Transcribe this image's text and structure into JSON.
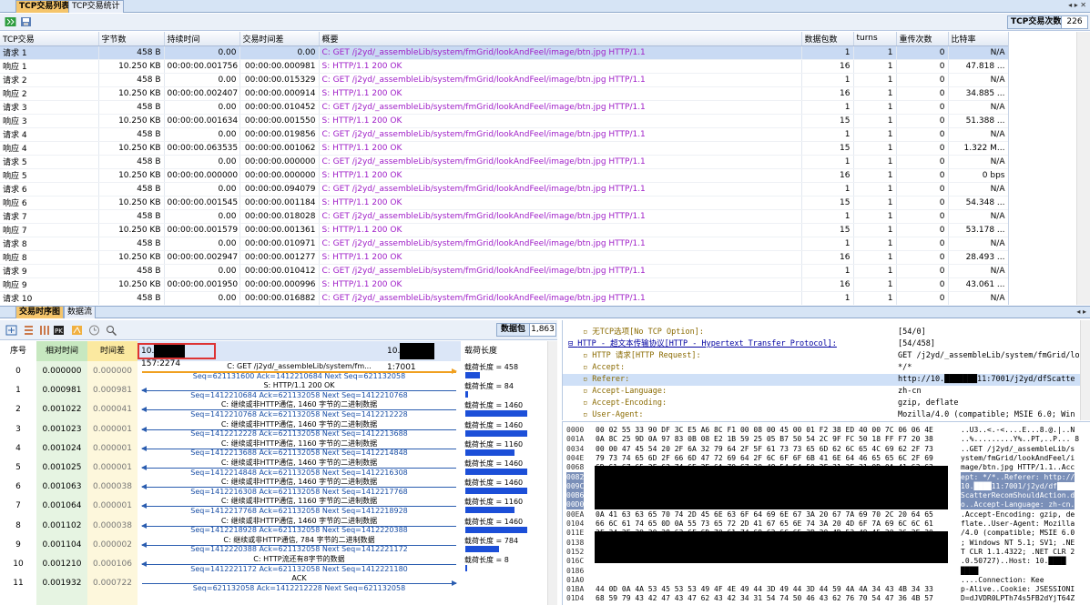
{
  "tabs_top": [
    "TCP交易列表",
    "TCP交易统计"
  ],
  "toolbar1": {
    "count_label": "TCP交易次数",
    "count_value": "226"
  },
  "table": {
    "headers": [
      "TCP交易",
      "字节数",
      "持续时间",
      "交易时间差",
      "概要",
      "数据包数",
      "turns",
      "重传次数",
      "比特率"
    ],
    "rows": [
      [
        "请求 1",
        "458  B",
        "0.00",
        "0.00",
        "C: GET /j2yd/_assembleLib/system/fmGrid/lookAndFeel/image/btn.jpg HTTP/1.1",
        "1",
        "1",
        "0",
        "N/A"
      ],
      [
        "响应 1",
        "10.250  KB",
        "00:00:00.001756",
        "00:00:00.000981",
        "S: HTTP/1.1 200 OK",
        "16",
        "1",
        "0",
        "47.818 ..."
      ],
      [
        "请求 2",
        "458  B",
        "0.00",
        "00:00:00.015329",
        "C: GET /j2yd/_assembleLib/system/fmGrid/lookAndFeel/image/btn.jpg HTTP/1.1",
        "1",
        "1",
        "0",
        "N/A"
      ],
      [
        "响应 2",
        "10.250  KB",
        "00:00:00.002407",
        "00:00:00.000914",
        "S: HTTP/1.1 200 OK",
        "16",
        "1",
        "0",
        "34.885 ..."
      ],
      [
        "请求 3",
        "458  B",
        "0.00",
        "00:00:00.010452",
        "C: GET /j2yd/_assembleLib/system/fmGrid/lookAndFeel/image/btn.jpg HTTP/1.1",
        "1",
        "1",
        "0",
        "N/A"
      ],
      [
        "响应 3",
        "10.250  KB",
        "00:00:00.001634",
        "00:00:00.001550",
        "S: HTTP/1.1 200 OK",
        "15",
        "1",
        "0",
        "51.388 ..."
      ],
      [
        "请求 4",
        "458  B",
        "0.00",
        "00:00:00.019856",
        "C: GET /j2yd/_assembleLib/system/fmGrid/lookAndFeel/image/btn.jpg HTTP/1.1",
        "1",
        "1",
        "0",
        "N/A"
      ],
      [
        "响应 4",
        "10.250  KB",
        "00:00:00.063535",
        "00:00:00.001062",
        "S: HTTP/1.1 200 OK",
        "15",
        "1",
        "0",
        "1.322 M..."
      ],
      [
        "请求 5",
        "458  B",
        "0.00",
        "00:00:00.000000",
        "C: GET /j2yd/_assembleLib/system/fmGrid/lookAndFeel/image/btn.jpg HTTP/1.1",
        "1",
        "1",
        "0",
        "N/A"
      ],
      [
        "响应 5",
        "10.250  KB",
        "00:00:00.000000",
        "00:00:00.000000",
        "S: HTTP/1.1 200 OK",
        "16",
        "1",
        "0",
        "0 bps"
      ],
      [
        "请求 6",
        "458  B",
        "0.00",
        "00:00:00.094079",
        "C: GET /j2yd/_assembleLib/system/fmGrid/lookAndFeel/image/btn.jpg HTTP/1.1",
        "1",
        "1",
        "0",
        "N/A"
      ],
      [
        "响应 6",
        "10.250  KB",
        "00:00:00.001545",
        "00:00:00.001184",
        "S: HTTP/1.1 200 OK",
        "15",
        "1",
        "0",
        "54.348 ..."
      ],
      [
        "请求 7",
        "458  B",
        "0.00",
        "00:00:00.018028",
        "C: GET /j2yd/_assembleLib/system/fmGrid/lookAndFeel/image/btn.jpg HTTP/1.1",
        "1",
        "1",
        "0",
        "N/A"
      ],
      [
        "响应 7",
        "10.250  KB",
        "00:00:00.001579",
        "00:00:00.001361",
        "S: HTTP/1.1 200 OK",
        "15",
        "1",
        "0",
        "53.178 ..."
      ],
      [
        "请求 8",
        "458  B",
        "0.00",
        "00:00:00.010971",
        "C: GET /j2yd/_assembleLib/system/fmGrid/lookAndFeel/image/btn.jpg HTTP/1.1",
        "1",
        "1",
        "0",
        "N/A"
      ],
      [
        "响应 8",
        "10.250  KB",
        "00:00:00.002947",
        "00:00:00.001277",
        "S: HTTP/1.1 200 OK",
        "16",
        "1",
        "0",
        "28.493 ..."
      ],
      [
        "请求 9",
        "458  B",
        "0.00",
        "00:00:00.010412",
        "C: GET /j2yd/_assembleLib/system/fmGrid/lookAndFeel/image/btn.jpg HTTP/1.1",
        "1",
        "1",
        "0",
        "N/A"
      ],
      [
        "响应 9",
        "10.250  KB",
        "00:00:00.001950",
        "00:00:00.000996",
        "S: HTTP/1.1 200 OK",
        "16",
        "1",
        "0",
        "43.061 ..."
      ],
      [
        "请求 10",
        "458  B",
        "0.00",
        "00:00:00.016882",
        "C: GET /j2yd/_assembleLib/system/fmGrid/lookAndFeel/image/btn.jpg HTTP/1.1",
        "1",
        "1",
        "0",
        "N/A"
      ]
    ]
  },
  "tabs_mid": [
    "交易时序图",
    "数据流"
  ],
  "seq": {
    "packets_label": "数据包",
    "packets_value": "1,863",
    "headers": {
      "no": "序号",
      "rel": "相对时间",
      "delta": "时间差",
      "payload": "载荷长度"
    },
    "host_a": "10.",
    "host_a_port": "157:2274",
    "host_b": "10.",
    "host_b_port": "1:7001",
    "rows": [
      {
        "no": "0",
        "rel": "0.000000",
        "delta": "0.000000",
        "text": "C: GET /j2yd/_assembleLib/system/fm...",
        "seq": "Seq=621131600  Ack=1412210684  Next Seq=621132058",
        "dir": "r",
        "payload": "载荷长度 = 458",
        "bar": 0.23
      },
      {
        "no": "1",
        "rel": "0.000981",
        "delta": "0.000981",
        "text": "S: HTTP/1.1 200 OK",
        "seq": "Seq=1412210684  Ack=621132058  Next Seq=1412210768",
        "dir": "l",
        "payload": "载荷长度 = 84",
        "bar": 0.04
      },
      {
        "no": "2",
        "rel": "0.001022",
        "delta": "0.000041",
        "text": "C: 继续或非HTTP通信, 1460 字节的二进制数据",
        "seq": "Seq=1412210768  Ack=621132058  Next Seq=1412212228",
        "dir": "l",
        "payload": "载荷长度 = 1460",
        "bar": 1.0
      },
      {
        "no": "3",
        "rel": "0.001023",
        "delta": "0.000001",
        "text": "C: 继续或非HTTP通信, 1460 字节的二进制数据",
        "seq": "Seq=1412212228  Ack=621132058  Next Seq=1412213688",
        "dir": "l",
        "payload": "载荷长度 = 1460",
        "bar": 1.0
      },
      {
        "no": "4",
        "rel": "0.001024",
        "delta": "0.000001",
        "text": "C: 继续或非HTTP通信, 1160 字节的二进制数据",
        "seq": "Seq=1412213688  Ack=621132058  Next Seq=1412214848",
        "dir": "l",
        "payload": "载荷长度 = 1160",
        "bar": 0.8
      },
      {
        "no": "5",
        "rel": "0.001025",
        "delta": "0.000001",
        "text": "C: 继续或非HTTP通信, 1460 字节的二进制数据",
        "seq": "Seq=1412214848  Ack=621132058  Next Seq=1412216308",
        "dir": "l",
        "payload": "载荷长度 = 1460",
        "bar": 1.0
      },
      {
        "no": "6",
        "rel": "0.001063",
        "delta": "0.000038",
        "text": "C: 继续或非HTTP通信, 1460 字节的二进制数据",
        "seq": "Seq=1412216308  Ack=621132058  Next Seq=1412217768",
        "dir": "l",
        "payload": "载荷长度 = 1460",
        "bar": 1.0
      },
      {
        "no": "7",
        "rel": "0.001064",
        "delta": "0.000001",
        "text": "C: 继续或非HTTP通信, 1160 字节的二进制数据",
        "seq": "Seq=1412217768  Ack=621132058  Next Seq=1412218928",
        "dir": "l",
        "payload": "载荷长度 = 1160",
        "bar": 0.8
      },
      {
        "no": "8",
        "rel": "0.001102",
        "delta": "0.000038",
        "text": "C: 继续或非HTTP通信, 1460 字节的二进制数据",
        "seq": "Seq=1412218928  Ack=621132058  Next Seq=1412220388",
        "dir": "l",
        "payload": "载荷长度 = 1460",
        "bar": 1.0
      },
      {
        "no": "9",
        "rel": "0.001104",
        "delta": "0.000002",
        "text": "C: 继续或非HTTP通信, 784 字节的二进制数据",
        "seq": "Seq=1412220388  Ack=621132058  Next Seq=1412221172",
        "dir": "l",
        "payload": "载荷长度 = 784",
        "bar": 0.54
      },
      {
        "no": "10",
        "rel": "0.001210",
        "delta": "0.000106",
        "text": "C: HTTP流还有8字节的数据",
        "seq": "Seq=1412221172  Ack=621132058  Next Seq=1412221180",
        "dir": "l",
        "payload": "载荷长度 = 8",
        "bar": 0.01
      },
      {
        "no": "11",
        "rel": "0.001932",
        "delta": "0.000722",
        "text": "ACK",
        "seq": "Seq=621132058  Ack=1412212228  Next Seq=621132058",
        "dir": "r",
        "payload": "",
        "bar": 0
      }
    ]
  },
  "tree": {
    "rows": [
      {
        "name": "无TCP选项[No TCP Option]:",
        "value": "[54/0]",
        "cls": "tfield",
        "indent": 2
      },
      {
        "name": "HTTP - 超文本传输协议[HTTP - Hypertext Transfer Protocol]:",
        "value": "[54/458]",
        "cls": "tlink",
        "indent": 0
      },
      {
        "name": "HTTP 请求[HTTP Request]:",
        "value": "GET /j2yd/_assembleLib/system/fmGrid/loo",
        "cls": "tfield",
        "indent": 2
      },
      {
        "name": "Accept:",
        "value": "*/*",
        "cls": "tfield",
        "indent": 2
      },
      {
        "name": "Referer:",
        "value": "http://10.███████11:7001/j2yd/dfScatte",
        "cls": "tfield",
        "indent": 2,
        "sel": true
      },
      {
        "name": "Accept-Language:",
        "value": "zh-cn",
        "cls": "tfield",
        "indent": 2
      },
      {
        "name": "Accept-Encoding:",
        "value": "gzip, deflate",
        "cls": "tfield",
        "indent": 2
      },
      {
        "name": "User-Agent:",
        "value": "Mozilla/4.0 (compatible; MSIE 6.0; Win",
        "cls": "tfield",
        "indent": 2
      }
    ]
  },
  "hex": {
    "rows": [
      {
        "off": "0000",
        "bytes": "00 02 55 33 90 DF 3C E5 A6 8C F1 00 08 00 45 00 01 F2 38 ED 40 00 7C 06 06 4E",
        "asc": "..U3..<.-<....E...8.@.|..N"
      },
      {
        "off": "001A",
        "bytes": "0A 8C 25 9D 0A 97 83 0B 08 E2 1B 59 25 05 B7 50 54 2C 9F FC 50 18 FF F7 20 38",
        "asc": "..%.........Y%..PT,..P... 8"
      },
      {
        "off": "0034",
        "bytes": "00 00 47 45 54 20 2F 6A 32 79 64 2F 5F 61 73 73 65 6D 62 6C 65 4C 69 62 2F 73",
        "asc": "..GET /j2yd/_assembleLib/s"
      },
      {
        "off": "004E",
        "bytes": "79 73 74 65 6D 2F 66 6D 47 72 69 64 2F 6C 6F 6F 6B 41 6E 64 46 65 65 6C 2F 69",
        "asc": "ystem/fmGrid/lookAndFeel/i"
      },
      {
        "off": "0068",
        "bytes": "6D 61 67 65 2F 62 74 6E 2E 6A 70 67 20 48 54 54 50 2F 31 2E 31 0D 0A 41 63 63",
        "asc": "mage/btn.jpg HTTP/1.1..Acc"
      },
      {
        "off": "0082",
        "bytes": "",
        "asc": "ept: */*..Referer: http://",
        "sel": true
      },
      {
        "off": "009C",
        "bytes": "",
        "asc": "10.████11:7001/j2yd/df",
        "sel": true
      },
      {
        "off": "00B6",
        "bytes": "",
        "asc": "ScatterRecomShouldAction.d",
        "sel": true
      },
      {
        "off": "00D0",
        "bytes": "",
        "asc": "o..Accept-Language: zh-cn.",
        "sel": true
      },
      {
        "off": "00EA",
        "bytes": "0A 41 63 63 65 70 74 2D 45 6E 63 6F 64 69 6E 67 3A 20 67 7A 69 70 2C 20 64 65",
        "asc": ".Accept-Encoding: gzip, de"
      },
      {
        "off": "0104",
        "bytes": "66 6C 61 74 65 0D 0A 55 73 65 72 2D 41 67 65 6E 74 3A 20 4D 6F 7A 69 6C 6C 61",
        "asc": "flate..User-Agent: Mozilla"
      },
      {
        "off": "011E",
        "bytes": "2F 34 2E 30 20 28 63 6F 6D 70 61 74 69 62 6C 65 3B 20 4D 53 49 45 20 36 2E 30",
        "asc": "/4.0 (compatible; MSIE 6.0"
      },
      {
        "off": "0138",
        "bytes": "3B 20 57 69 6E 64 6F 77 73 20 4E 54 20 35 2E 31 3B 20 53 56 31 3B 20 2E 4E 45",
        "asc": "; Windows NT 5.1; SV1; .NE"
      },
      {
        "off": "0152",
        "bytes": "",
        "asc": "T CLR 1.1.4322; .NET CLR 2"
      },
      {
        "off": "016C",
        "bytes": "",
        "asc": ".0.50727)..Host: 10.████"
      },
      {
        "off": "0186",
        "bytes": "",
        "asc": "████"
      },
      {
        "off": "01A0",
        "bytes": "",
        "asc": "....Connection: Kee"
      },
      {
        "off": "01BA",
        "bytes": "44 0D 0A 4A 53 45 53 53 49 4F 4E 49 44 3D 49 44 3D 44 59 4A 4A 34 43 4B 34 33",
        "asc": "p-Alive..Cookie: JSESSIONI"
      },
      {
        "off": "01D4",
        "bytes": "68 59 79 43 42 47 43 47 62 43 42 34 31 54 74 50 46 43 62 76 70 54 47 36 4B 57",
        "asc": "D=dJVDR0LPTh74s5FB2dYjT64Z"
      },
      {
        "off": "01EE",
        "bytes": "",
        "asc": "hYyCBGCGbCB41TtPFCbvpTG6KW"
      }
    ]
  }
}
